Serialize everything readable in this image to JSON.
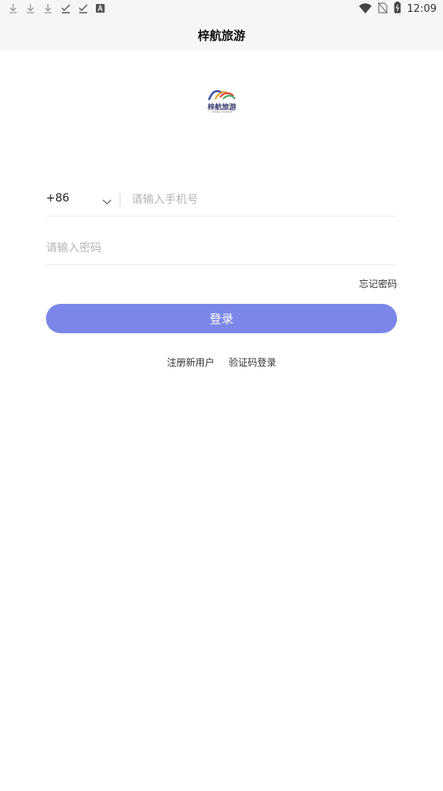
{
  "status_bar": {
    "left_icons": [
      "download-icon",
      "download-icon",
      "download-icon",
      "check-icon",
      "check-icon",
      "font-icon"
    ],
    "time": "12:09"
  },
  "header": {
    "title": "梓航旅游"
  },
  "logo": {
    "name": "梓航旅游",
    "subtitle": "ZIHANG TOURISM"
  },
  "login_form": {
    "country_code": "+86",
    "phone_placeholder": "请输入手机号",
    "password_placeholder": "请输入密码",
    "forgot_password": "忘记密码",
    "login_button": "登录",
    "register_link": "注册新用户",
    "sms_login_link": "验证码登录"
  },
  "colors": {
    "accent": "#7b87e8",
    "header_bg": "#f6f6f6",
    "placeholder": "#b5b5b5"
  }
}
